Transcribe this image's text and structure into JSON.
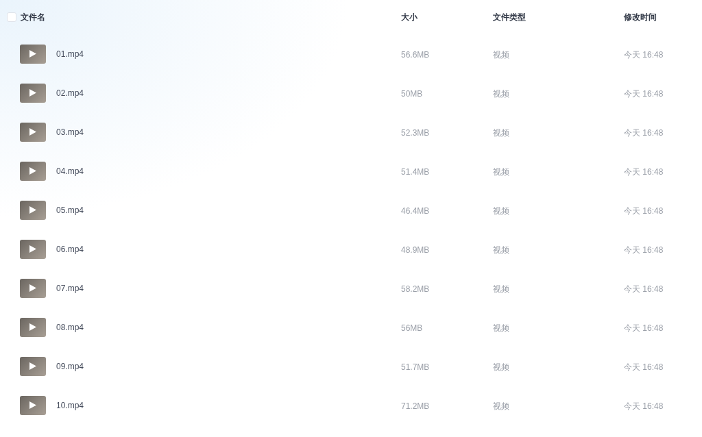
{
  "header": {
    "select_all": {
      "checked": false
    },
    "columns": [
      "文件名",
      "大小",
      "文件类型",
      "修改时间"
    ]
  },
  "rows": [
    {
      "name": "01.mp4",
      "size": "56.6MB",
      "type": "视频",
      "modified": "今天 16:48"
    },
    {
      "name": "02.mp4",
      "size": "50MB",
      "type": "视频",
      "modified": "今天 16:48"
    },
    {
      "name": "03.mp4",
      "size": "52.3MB",
      "type": "视频",
      "modified": "今天 16:48"
    },
    {
      "name": "04.mp4",
      "size": "51.4MB",
      "type": "视频",
      "modified": "今天 16:48"
    },
    {
      "name": "05.mp4",
      "size": "46.4MB",
      "type": "视频",
      "modified": "今天 16:48"
    },
    {
      "name": "06.mp4",
      "size": "48.9MB",
      "type": "视频",
      "modified": "今天 16:48"
    },
    {
      "name": "07.mp4",
      "size": "58.2MB",
      "type": "视频",
      "modified": "今天 16:48"
    },
    {
      "name": "08.mp4",
      "size": "56MB",
      "type": "视频",
      "modified": "今天 16:48"
    },
    {
      "name": "09.mp4",
      "size": "51.7MB",
      "type": "视频",
      "modified": "今天 16:48"
    },
    {
      "name": "10.mp4",
      "size": "71.2MB",
      "type": "视频",
      "modified": "今天 16:48"
    }
  ]
}
